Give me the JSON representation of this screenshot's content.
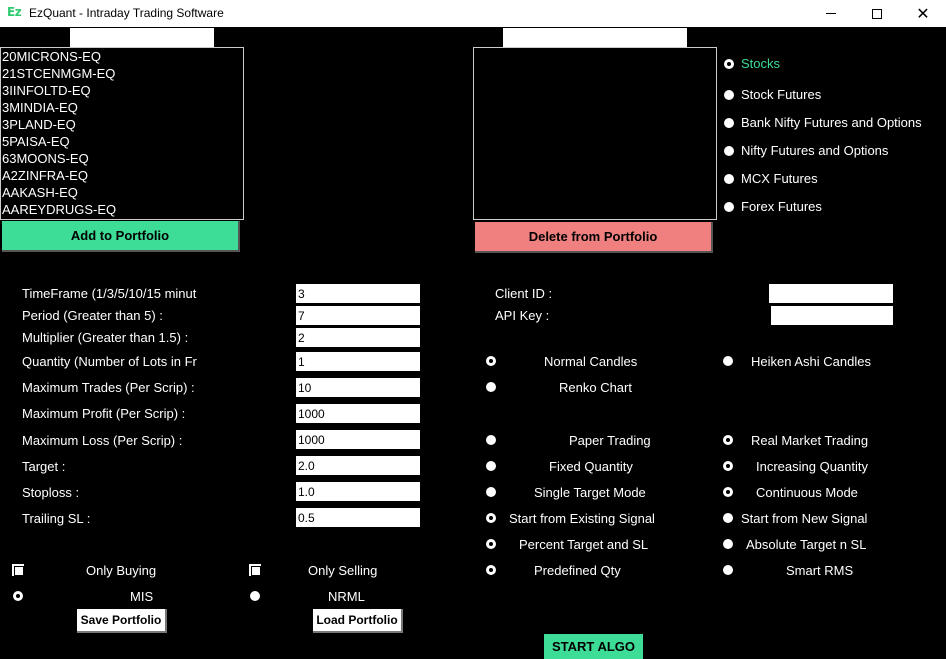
{
  "window": {
    "logo": "Ez",
    "title": "EzQuant - Intraday Trading Software"
  },
  "left_list": {
    "search_value": "",
    "items": [
      "20MICRONS-EQ",
      "21STCENMGM-EQ",
      "3IINFOLTD-EQ",
      "3MINDIA-EQ",
      "3PLAND-EQ",
      "5PAISA-EQ",
      "63MOONS-EQ",
      "A2ZINFRA-EQ",
      "AAKASH-EQ",
      "AAREYDRUGS-EQ"
    ],
    "add_button": "Add to Portfolio"
  },
  "right_list": {
    "search_value": "",
    "items": [],
    "delete_button": "Delete from Portfolio"
  },
  "segments": [
    {
      "label": "Stocks",
      "selected": true
    },
    {
      "label": "Stock Futures",
      "selected": false
    },
    {
      "label": "Bank Nifty Futures and Options",
      "selected": false
    },
    {
      "label": "Nifty Futures and Options",
      "selected": false
    },
    {
      "label": "MCX Futures",
      "selected": false
    },
    {
      "label": "Forex Futures",
      "selected": false
    }
  ],
  "params": [
    {
      "label": "TimeFrame (1/3/5/10/15 minut",
      "value": "3"
    },
    {
      "label": "Period (Greater than 5) :",
      "value": "7"
    },
    {
      "label": "Multiplier (Greater than 1.5) :",
      "value": "2"
    },
    {
      "label": "Quantity (Number of Lots in Fr",
      "value": "1"
    },
    {
      "label": "Maximum Trades (Per Scrip) :",
      "value": "10"
    },
    {
      "label": "Maximum Profit (Per Scrip) :",
      "value": "1000"
    },
    {
      "label": "Maximum Loss (Per Scrip) :",
      "value": "1000"
    },
    {
      "label": "Target :",
      "value": "2.0"
    },
    {
      "label": "Stoploss :",
      "value": "1.0"
    },
    {
      "label": "Trailing SL :",
      "value": "0.5"
    }
  ],
  "credentials": {
    "client_id_label": "Client ID :",
    "client_id_value": "",
    "api_key_label": "API Key :",
    "api_key_value": ""
  },
  "option_pairs": [
    {
      "left": "Normal Candles",
      "left_selected": true,
      "right": "Heiken Ashi Candles",
      "right_selected": false
    },
    {
      "left": "Renko Chart",
      "left_selected": false,
      "right": "",
      "right_selected": false
    },
    {
      "left": "Paper Trading",
      "left_selected": false,
      "right": "Real Market Trading",
      "right_selected": true
    },
    {
      "left": "Fixed Quantity",
      "left_selected": false,
      "right": "Increasing Quantity",
      "right_selected": true
    },
    {
      "left": "Single Target Mode",
      "left_selected": false,
      "right": "Continuous Mode",
      "right_selected": true
    },
    {
      "left": "Start from Existing Signal",
      "left_selected": true,
      "right": "Start from New Signal",
      "right_selected": false
    },
    {
      "left": "Percent Target and SL",
      "left_selected": true,
      "right": "Absolute Target n SL",
      "right_selected": false
    },
    {
      "left": "Predefined Qty",
      "left_selected": true,
      "right": "Smart RMS",
      "right_selected": false
    }
  ],
  "direction": {
    "only_buying": "Only Buying",
    "only_selling": "Only Selling"
  },
  "product": {
    "mis": "MIS",
    "mis_selected": true,
    "nrml": "NRML",
    "nrml_selected": false
  },
  "buttons": {
    "save_portfolio": "Save Portfolio",
    "load_portfolio": "Load Portfolio",
    "start_algo": "START ALGO"
  },
  "colors": {
    "accent_green": "#3ddc97",
    "delete_red": "#f08080",
    "background": "#000000"
  }
}
